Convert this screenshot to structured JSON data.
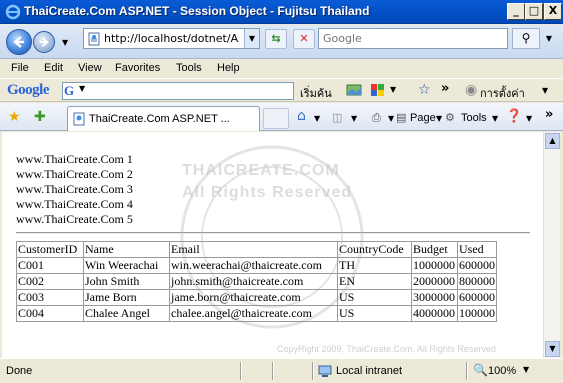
{
  "window": {
    "title": "ThaiCreate.Com ASP.NET - Session Object - Fujitsu Thailand",
    "minimize": "_",
    "maximize": "□",
    "close": "X"
  },
  "addressbar": {
    "url": "http://localhost/dotnet/AspN",
    "search_placeholder": "Google"
  },
  "menu": {
    "items": [
      "File",
      "Edit",
      "View",
      "Favorites",
      "Tools",
      "Help"
    ]
  },
  "google_toolbar": {
    "logo": "Google",
    "search_label": "เริ่มค้น",
    "more": "»",
    "settings_label": "การตั้งค่า"
  },
  "tabs": {
    "active_label": "ThaiCreate.Com ASP.NET ...",
    "page_label": "Page",
    "tools_label": "Tools",
    "more": "»"
  },
  "page": {
    "lines": [
      "www.ThaiCreate.Com 1",
      "www.ThaiCreate.Com 2",
      "www.ThaiCreate.Com 3",
      "www.ThaiCreate.Com 4",
      "www.ThaiCreate.Com 5"
    ],
    "watermark_line1": "THAICREATE.COM",
    "watermark_line2": "All Rights Reserved",
    "copyright": "CopyRight 2009, ThaiCreate.Com, All Rights Reserved",
    "table": {
      "headers": [
        "CustomerID",
        "Name",
        "Email",
        "CountryCode",
        "Budget",
        "Used"
      ],
      "rows": [
        [
          "C001",
          "Win Weerachai",
          "win.weerachai@thaicreate.com",
          "TH",
          "1000000",
          "600000"
        ],
        [
          "C002",
          "John Smith",
          "john.smith@thaicreate.com",
          "EN",
          "2000000",
          "800000"
        ],
        [
          "C003",
          "Jame Born",
          "jame.born@thaicreate.com",
          "US",
          "3000000",
          "600000"
        ],
        [
          "C004",
          "Chalee Angel",
          "chalee.angel@thaicreate.com",
          "US",
          "4000000",
          "100000"
        ]
      ]
    }
  },
  "statusbar": {
    "status": "Done",
    "zone": "Local intranet",
    "zoom": "100%"
  }
}
